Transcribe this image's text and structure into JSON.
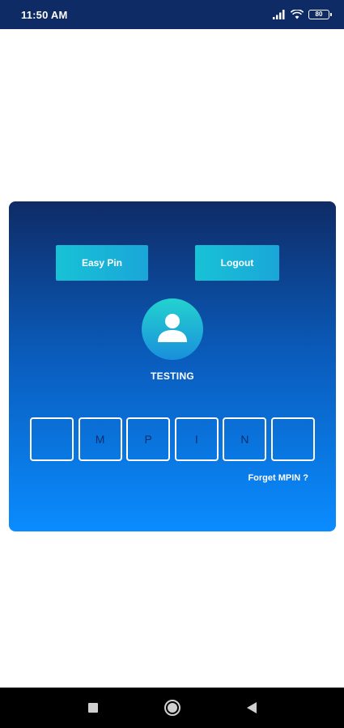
{
  "status_bar": {
    "time": "11:50 AM",
    "battery_level": "80",
    "icons": [
      "signal-icon",
      "wifi-icon",
      "battery-icon"
    ]
  },
  "login_card": {
    "easy_pin_label": "Easy Pin",
    "logout_label": "Logout",
    "avatar_icon": "user-avatar-icon",
    "username": "TESTING",
    "pin_placeholders": [
      "",
      "M",
      "P",
      "I",
      "N",
      ""
    ],
    "forgot_label": "Forget MPIN ?"
  },
  "nav_bar": {
    "icons": [
      "recent-apps-icon",
      "home-icon",
      "back-icon"
    ]
  },
  "colors": {
    "status_bar": "#0f2b66",
    "card_top": "#0f2b66",
    "card_bottom": "#0a8cff",
    "button": "#18c2d6",
    "nav_bar": "#000000"
  }
}
